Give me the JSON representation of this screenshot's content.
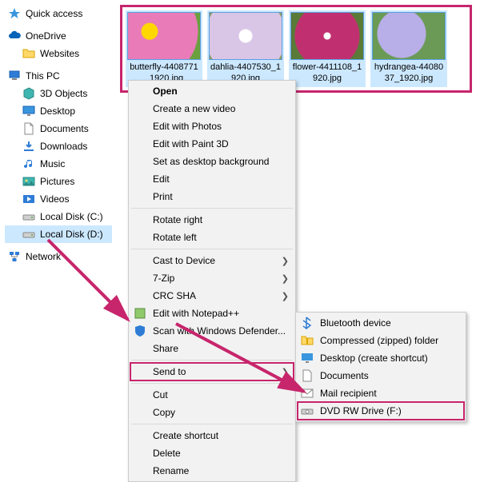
{
  "nav": {
    "quick_access": "Quick access",
    "onedrive": "OneDrive",
    "websites": "Websites",
    "this_pc": "This PC",
    "objects3d": "3D Objects",
    "desktop": "Desktop",
    "documents": "Documents",
    "downloads": "Downloads",
    "music": "Music",
    "pictures": "Pictures",
    "videos": "Videos",
    "local_c": "Local Disk (C:)",
    "local_d": "Local Disk (D:)",
    "network": "Network"
  },
  "thumbs": {
    "t0": "butterfly-4408771_1920.jpg",
    "t1": "dahlia-4407530_1920.jpg",
    "t2": "flower-4411108_1920.jpg",
    "t3": "hydrangea-4408037_1920.jpg"
  },
  "menu": {
    "open": "Open",
    "new_video": "Create a new video",
    "edit_photos": "Edit with Photos",
    "edit_paint3d": "Edit with Paint 3D",
    "set_bg": "Set as desktop background",
    "edit": "Edit",
    "print": "Print",
    "rotate_right": "Rotate right",
    "rotate_left": "Rotate left",
    "cast": "Cast to Device",
    "sevenzip": "7-Zip",
    "crc": "CRC SHA",
    "notepadpp": "Edit with Notepad++",
    "defender": "Scan with Windows Defender...",
    "share": "Share",
    "send_to": "Send to",
    "cut": "Cut",
    "copy": "Copy",
    "create_shortcut": "Create shortcut",
    "delete": "Delete",
    "rename": "Rename"
  },
  "submenu": {
    "bluetooth": "Bluetooth device",
    "zip": "Compressed (zipped) folder",
    "desktop_sc": "Desktop (create shortcut)",
    "documents": "Documents",
    "mail": "Mail recipient",
    "dvd": "DVD RW Drive (F:)"
  }
}
